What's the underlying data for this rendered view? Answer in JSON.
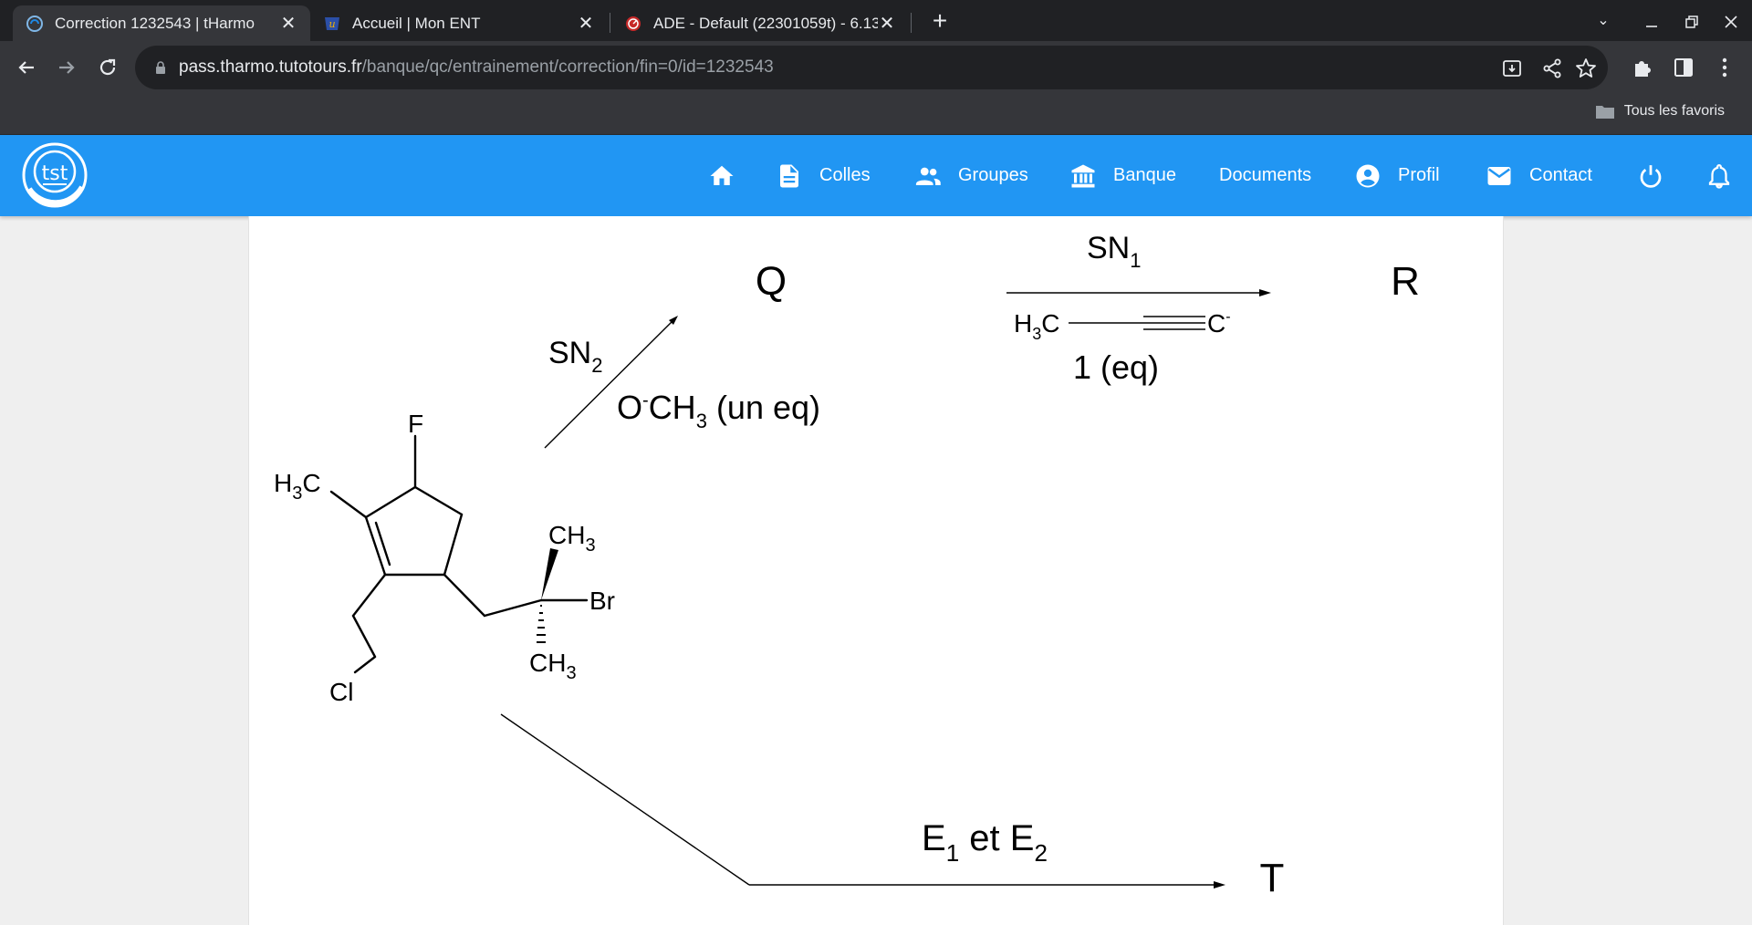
{
  "browser": {
    "tabs": [
      {
        "title": "Correction 1232543 | tHarmo",
        "active": true,
        "icon": "tharmo-favicon-icon"
      },
      {
        "title": "Accueil | Mon ENT",
        "active": false,
        "icon": "ent-favicon-icon"
      },
      {
        "title": "ADE - Default (22301059t) - 6.13",
        "active": false,
        "icon": "ade-favicon-icon"
      }
    ],
    "url_host": "pass.tharmo.tutotours.fr",
    "url_path": "/banque/qc/entrainement/correction/fin=0/id=1232543",
    "bookmark_folder": "Tous les favoris"
  },
  "site": {
    "accent_color": "#2196f3",
    "logo_text": "tst",
    "nav": [
      {
        "label": "",
        "icon": "home-icon"
      },
      {
        "label": "Colles",
        "icon": "document-icon"
      },
      {
        "label": "Groupes",
        "icon": "people-icon"
      },
      {
        "label": "Banque",
        "icon": "bank-icon"
      },
      {
        "label": "Documents",
        "icon": ""
      },
      {
        "label": "Profil",
        "icon": "account-circle-icon"
      },
      {
        "label": "Contact",
        "icon": "mail-icon"
      },
      {
        "label": "",
        "icon": "power-icon"
      },
      {
        "label": "",
        "icon": "bell-icon"
      }
    ]
  },
  "scheme": {
    "product_q": "Q",
    "product_r": "R",
    "product_t": "T",
    "sn2_label_main": "SN",
    "sn2_label_sub": "2",
    "methoxide_o": "O",
    "methoxide_charge": "-",
    "methoxide_ch": "CH",
    "methoxide_sub": "3",
    "methoxide_eq": " (un eq)",
    "sn1_label_main": "SN",
    "sn1_label_sub": "1",
    "propyne_h": "H",
    "propyne_sub": "3",
    "propyne_c": "C",
    "propyne_carbanion": "C",
    "propyne_charge": "-",
    "propyne_eq": "1 (eq)",
    "elim_e1": "E",
    "elim_e1_sub": "1",
    "elim_et": " et ",
    "elim_e2": "E",
    "elim_e2_sub": "2",
    "mol_f": "F",
    "mol_h3c_h": "H",
    "mol_h3c_sub": "3",
    "mol_h3c_c": "C",
    "mol_cl": "Cl",
    "mol_ch3_top": "CH",
    "mol_ch3_top_sub": "3",
    "mol_br": "Br",
    "mol_ch3_bottom": "CH",
    "mol_ch3_bottom_sub": "3"
  }
}
